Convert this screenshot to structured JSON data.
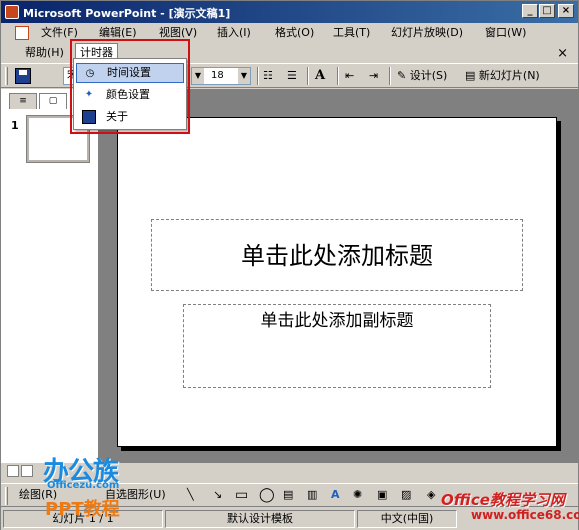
{
  "window": {
    "title": "Microsoft PowerPoint - [演示文稿1]",
    "min_label": "_",
    "max_label": "□",
    "close_label": "×"
  },
  "menu": {
    "row1": [
      "文件(F)",
      "编辑(E)",
      "视图(V)",
      "插入(I)",
      "格式(O)",
      "工具(T)",
      "幻灯片放映(D)",
      "窗口(W)"
    ],
    "row2": [
      "帮助(H)",
      "计时器"
    ],
    "doc_close": "×"
  },
  "timer_menu": {
    "items": [
      {
        "label": "时间设置",
        "icon": "clock-icon",
        "highlighted": true
      },
      {
        "label": "颜色设置",
        "icon": "palette-icon",
        "highlighted": false
      },
      {
        "label": "关于",
        "icon": "save-disk-icon",
        "highlighted": false
      }
    ]
  },
  "toolbar": {
    "font_name": "宋",
    "font_size": "18",
    "design_label": "设计(S)",
    "new_slide_label": "新幻灯片(N)"
  },
  "panel": {
    "tab_outline": "≡",
    "tab_slides": "▢",
    "slide_number": "1"
  },
  "slide": {
    "title_placeholder": "单击此处添加标题",
    "subtitle_placeholder": "单击此处添加副标题"
  },
  "drawbar": {
    "draw_label": "绘图(R)",
    "autoshape_label": "自选图形(U)"
  },
  "status": {
    "slide_info": "幻灯片 1 / 1",
    "template": "默认设计模板",
    "language": "中文(中国)"
  },
  "watermarks": {
    "logo": "办公族",
    "site": "Officezu.com",
    "ppt": "PPT教程",
    "right_logo": "Office教程学习网",
    "right_url": "www.office68.com"
  },
  "colors": {
    "title_bar_start": "#0a246a",
    "title_bar_end": "#3a6ea5",
    "highlight": "#c1d2ee",
    "red_frame": "#d01010"
  }
}
